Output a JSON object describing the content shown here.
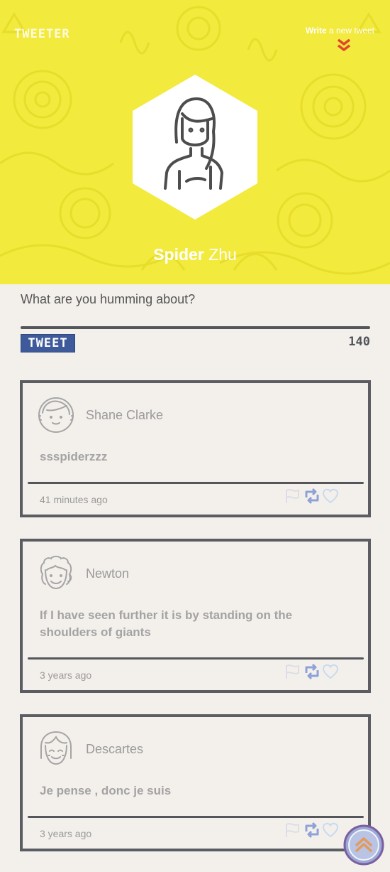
{
  "header": {
    "logo": "TWEETER",
    "write_bold": "Write",
    "write_rest": " a new tweet",
    "colors": {
      "background": "#f2ea3c",
      "accent": "#e0452e"
    }
  },
  "profile": {
    "first": "Spider",
    "last": " Zhu",
    "avatar_icon": "woman-avatar-icon"
  },
  "compose": {
    "prompt": "What are you humming about?",
    "button_label": "TWEET",
    "char_count": "140",
    "button_color": "#3f5a9a"
  },
  "tweets": [
    {
      "author": "Shane Clarke",
      "text": "ssspiderzzz",
      "time": "41 minutes ago",
      "avatar_icon": "man-avatar-icon"
    },
    {
      "author": "Newton",
      "text": "If I have seen further it is by standing on the shoulders of giants",
      "time": "3 years ago",
      "avatar_icon": "curly-hair-avatar-icon"
    },
    {
      "author": "Descartes",
      "text": "Je pense , donc je suis",
      "time": "3 years ago",
      "avatar_icon": "bob-hair-avatar-icon"
    }
  ],
  "icons": {
    "flag": "flag-icon",
    "retweet": "retweet-icon",
    "like": "heart-icon",
    "scroll_top": "double-chevron-up-icon"
  }
}
